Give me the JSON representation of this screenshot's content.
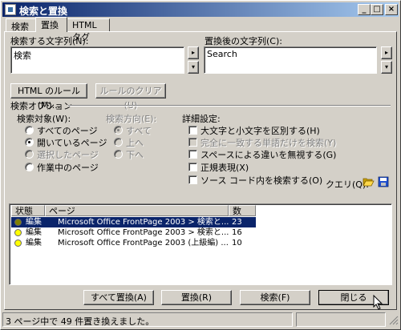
{
  "window": {
    "title": "検索と置換",
    "minimize": "_",
    "maximize": "□",
    "close": "×"
  },
  "tabs": [
    {
      "label": "検索"
    },
    {
      "label": "置換"
    },
    {
      "label": "HTML タグ"
    }
  ],
  "search": {
    "label": "検索する文字列(N):",
    "value": "検索"
  },
  "replace": {
    "label": "置換後の文字列(C):",
    "value": "Search"
  },
  "spinner": {
    "right": "▸",
    "down": "▾"
  },
  "buttons": {
    "html_rules": "HTML のルール(M)...",
    "clear_rules": "ルールのクリア(U)",
    "replace_all": "すべて置換(A)",
    "replace": "置換(R)",
    "find": "検索(F)",
    "close": "閉じる"
  },
  "options": {
    "group_label": "検索オプション",
    "target_label": "検索対象(W):",
    "targets": [
      {
        "label": "すべてのページ",
        "selected": false,
        "disabled": false
      },
      {
        "label": "開いているページ",
        "selected": true,
        "disabled": false
      },
      {
        "label": "選択したページ",
        "selected": false,
        "disabled": true
      },
      {
        "label": "作業中のページ",
        "selected": false,
        "disabled": false
      }
    ],
    "direction_label": "検索方向(E):",
    "directions": [
      {
        "label": "すべて",
        "selected": true
      },
      {
        "label": "上へ",
        "selected": false
      },
      {
        "label": "下へ",
        "selected": false
      }
    ],
    "advanced_label": "詳細設定:",
    "checks": [
      {
        "label": "大文字と小文字を区別する(H)",
        "checked": false,
        "disabled": false
      },
      {
        "label": "完全に一致する単語だけを検索(Y)",
        "checked": false,
        "disabled": true
      },
      {
        "label": "スペースによる違いを無視する(G)",
        "checked": false,
        "disabled": false
      },
      {
        "label": "正規表現(X)",
        "checked": false,
        "disabled": false
      },
      {
        "label": "ソース コード内を検索する(O)",
        "checked": false,
        "disabled": false
      }
    ],
    "query_label": "クエリ(Q):"
  },
  "results": {
    "columns": [
      "状態",
      "ページ",
      "数"
    ],
    "rows": [
      {
        "status": "編集",
        "page": "Microsoft Office FrontPage 2003 > 検索と...",
        "count": "23",
        "dot": "#808000",
        "selected": true
      },
      {
        "status": "編集",
        "page": "Microsoft Office FrontPage 2003 > 検索と...",
        "count": "16",
        "dot": "#ffff00",
        "selected": false
      },
      {
        "status": "編集",
        "page": "Microsoft Office FrontPage 2003 (上級編) ...",
        "count": "10",
        "dot": "#ffff00",
        "selected": false
      }
    ]
  },
  "statusbar": {
    "text": "3 ページ中で 49 件置き換えました。"
  },
  "colors": {
    "titlebar": "#0a246a",
    "selection": "#0a246a",
    "face": "#d4d0c8"
  }
}
